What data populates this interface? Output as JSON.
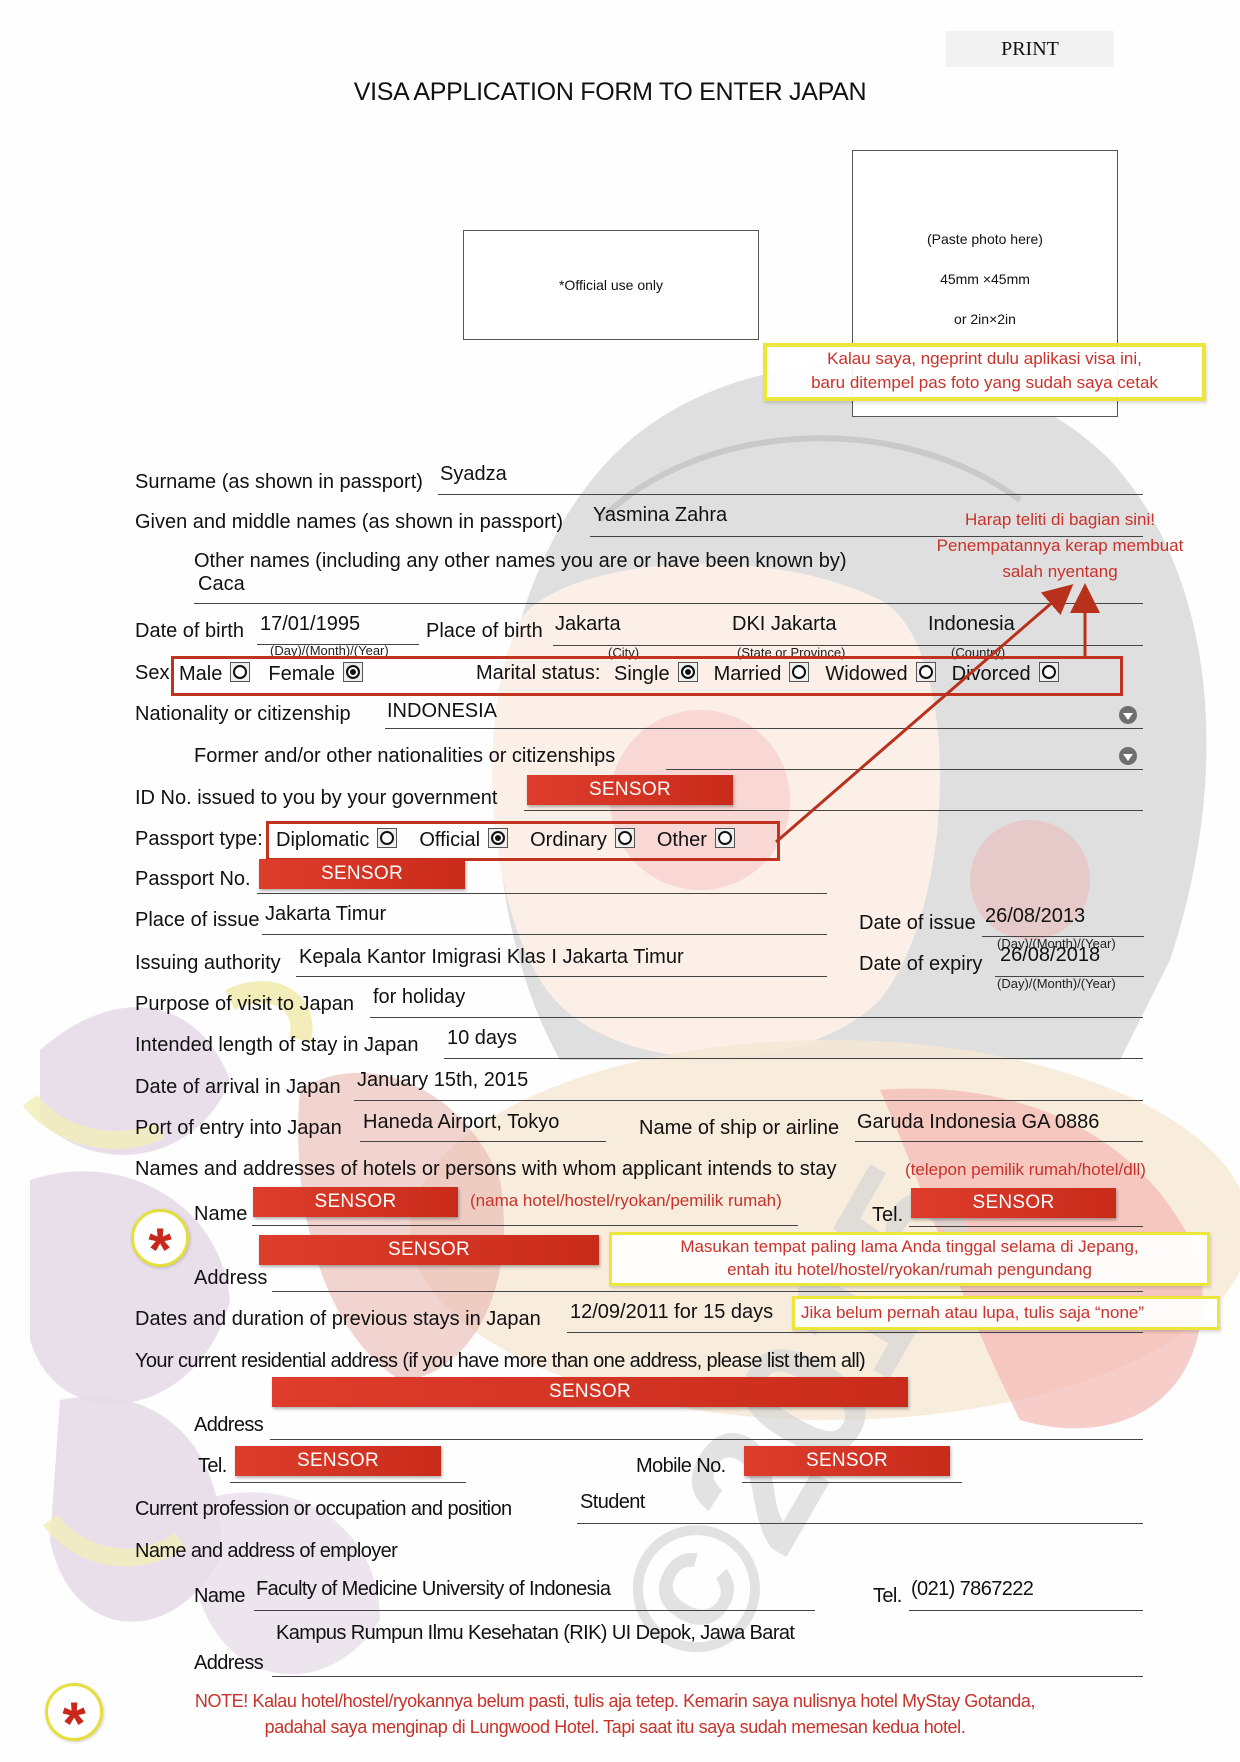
{
  "toolbar": {
    "print_label": "PRINT"
  },
  "form": {
    "title": "VISA APPLICATION FORM TO ENTER JAPAN",
    "official_use": "*Official use only",
    "photo": {
      "line1": "(Paste photo here)",
      "line2": "45mm ×45mm",
      "line3": "or 2in×2in"
    },
    "surname": {
      "label": "Surname (as shown in passport)",
      "value": "Syadza"
    },
    "given_names": {
      "label": "Given and middle names (as shown in passport)",
      "value": "Yasmina Zahra"
    },
    "other_names": {
      "label": "Other names (including any other names you are or have been known by)",
      "value": "Caca"
    },
    "date_of_birth": {
      "label": "Date of birth",
      "value": "17/01/1995",
      "hint": "(Day)/(Month)/(Year)"
    },
    "place_of_birth": {
      "label": "Place of birth",
      "city": "Jakarta",
      "city_hint": "(City)",
      "state": "DKI Jakarta",
      "state_hint": "(State or Province)",
      "country": "Indonesia",
      "country_hint": "(Country)"
    },
    "sex": {
      "label": "Sex:",
      "options": [
        {
          "label": "Male",
          "selected": false
        },
        {
          "label": "Female",
          "selected": true
        }
      ]
    },
    "marital_status": {
      "label": "Marital status:",
      "options": [
        {
          "label": "Single",
          "selected": true
        },
        {
          "label": "Married",
          "selected": false
        },
        {
          "label": "Widowed",
          "selected": false
        },
        {
          "label": "Divorced",
          "selected": false
        }
      ]
    },
    "nationality": {
      "label": "Nationality or citizenship",
      "value": "INDONESIA"
    },
    "former_nationality": {
      "label": "Former and/or other nationalities or citizenships",
      "value": ""
    },
    "id_no": {
      "label": "ID No. issued to you by your government",
      "value": "SENSOR"
    },
    "passport_type": {
      "label": "Passport type:",
      "options": [
        {
          "label": "Diplomatic",
          "selected": false
        },
        {
          "label": "Official",
          "selected": true
        },
        {
          "label": "Ordinary",
          "selected": false
        },
        {
          "label": "Other",
          "selected": false
        }
      ]
    },
    "passport_no": {
      "label": "Passport No.",
      "value": "SENSOR"
    },
    "place_of_issue": {
      "label": "Place of issue",
      "value": "Jakarta Timur"
    },
    "date_of_issue": {
      "label": "Date of issue",
      "value": "26/08/2013",
      "hint": "(Day)/(Month)/(Year)"
    },
    "issuing_authority": {
      "label": "Issuing authority",
      "value": "Kepala Kantor Imigrasi Klas I Jakarta Timur"
    },
    "date_of_expiry": {
      "label": "Date of expiry",
      "value": "26/08/2018",
      "hint": "(Day)/(Month)/(Year)"
    },
    "purpose": {
      "label": "Purpose of visit to Japan",
      "value": "for holiday"
    },
    "length_of_stay": {
      "label": "Intended length of stay in Japan",
      "value": "10 days"
    },
    "arrival_date": {
      "label": "Date of arrival in Japan",
      "value": "January 15th, 2015"
    },
    "port_of_entry": {
      "label": "Port of entry into Japan",
      "value": "Haneda Airport, Tokyo"
    },
    "airline": {
      "label": "Name of ship or airline",
      "value": "Garuda Indonesia GA 0886"
    },
    "hotels": {
      "label": "Names and addresses of hotels or persons with whom applicant intends to stay",
      "name_label": "Name",
      "name_value": "SENSOR",
      "tel_label": "Tel.",
      "tel_value": "SENSOR",
      "address_label": "Address",
      "address_value": "SENSOR"
    },
    "previous_stays": {
      "label": "Dates and duration of previous stays in Japan",
      "value": "12/09/2011 for 15 days"
    },
    "residential": {
      "label": "Your current residential address (if you have more than one address, please list them all)",
      "address_label": "Address",
      "address_value": "SENSOR",
      "tel_label": "Tel.",
      "tel_value": "SENSOR",
      "mobile_label": "Mobile No.",
      "mobile_value": "SENSOR"
    },
    "profession": {
      "label": "Current profession or occupation and position",
      "value": "Student"
    },
    "employer": {
      "label": "Name and address of employer",
      "name_label": "Name",
      "name_value": "Faculty of Medicine University of Indonesia",
      "tel_label": "Tel.",
      "tel_value": "(021) 7867222",
      "address_label": "Address",
      "address_value": "Kampus Rumpun Ilmu Kesehatan (RIK) UI Depok, Jawa Barat"
    }
  },
  "annotations": {
    "photo_note": [
      "Kalau saya, ngeprint dulu aplikasi visa ini,",
      "baru ditempel pas foto yang sudah saya cetak"
    ],
    "checkbox_note": [
      "Harap teliti di bagian sini!",
      "Penempatannya kerap membuat",
      "salah nyentang"
    ],
    "hotel_tel_note": "(telepon pemilik rumah/hotel/dll)",
    "hotel_name_note": "(nama hotel/hostel/ryokan/pemilik rumah)",
    "hotel_address_note": [
      "Masukan tempat paling lama Anda tinggal selama di Jepang,",
      "entah itu hotel/hostel/ryokan/rumah pengundang"
    ],
    "previous_stay_note": "Jika belum pernah atau lupa, tulis saja “none”",
    "footer_note": [
      "NOTE! Kalau hotel/hostel/ryokannya belum pasti, tulis aja tetep. Kemarin saya nulisnya hotel MyStay Gotanda,",
      "padahal saya menginap di Lungwood Hotel. Tapi saat itu saya sudah memesan kedua hotel."
    ],
    "star_symbol": "*",
    "watermark": "©2015"
  },
  "colors": {
    "annotation_red": "#c8322a",
    "highlight_yellow": "#ece53a",
    "sensor_red": "#d6321f",
    "frame_red": "#c0341f"
  }
}
